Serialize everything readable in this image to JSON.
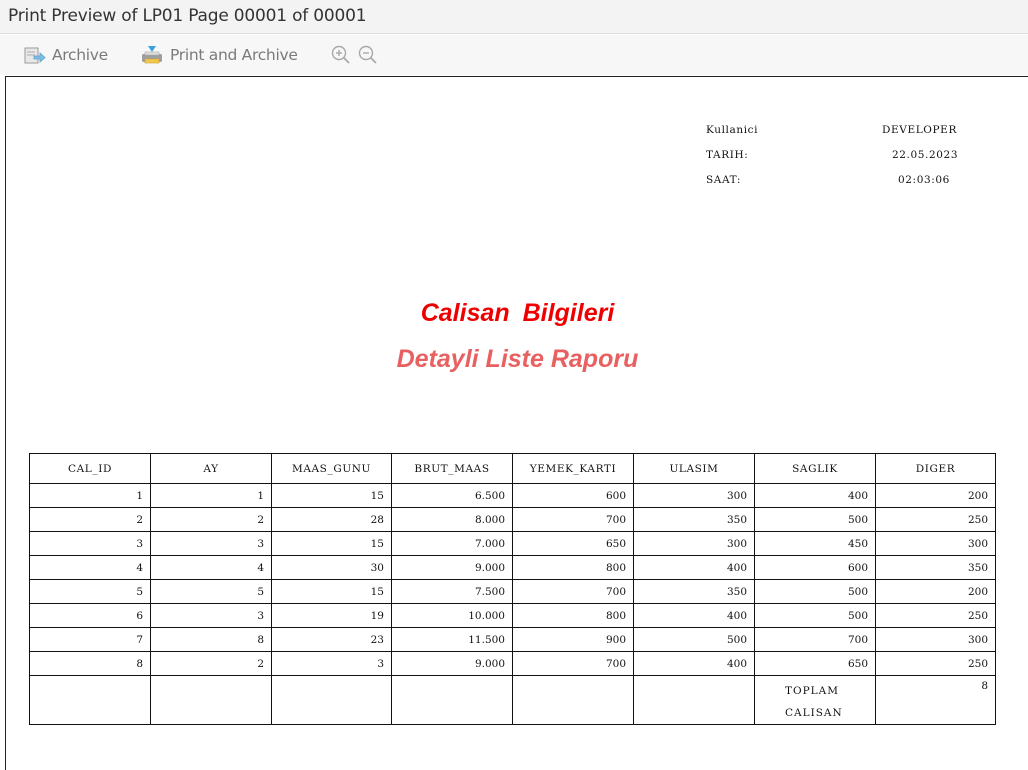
{
  "window": {
    "title": "Print Preview of LP01 Page 00001 of 00001"
  },
  "toolbar": {
    "archive_label": "Archive",
    "print_archive_label": "Print and Archive",
    "icons": [
      "archive-icon",
      "print-archive-icon",
      "zoom-in-icon",
      "zoom-out-icon"
    ]
  },
  "report": {
    "meta": {
      "user_label": "Kullanici",
      "user_value": "DEVELOPER",
      "date_label": "TARIH:",
      "date_value": "22.05.2023",
      "time_label": "SAAT:",
      "time_value": "02:03:06"
    },
    "title": "Calisan  Bilgileri",
    "subtitle": "Detayli Liste Raporu",
    "columns": [
      "CAL_ID",
      "AY",
      "MAAS_GUNU",
      "BRUT_MAAS",
      "YEMEK_KARTI",
      "ULASIM",
      "SAGLIK",
      "DIGER"
    ],
    "rows": [
      [
        "1",
        "1",
        "15",
        "6.500",
        "600",
        "300",
        "400",
        "200"
      ],
      [
        "2",
        "2",
        "28",
        "8.000",
        "700",
        "350",
        "500",
        "250"
      ],
      [
        "3",
        "3",
        "15",
        "7.000",
        "650",
        "300",
        "450",
        "300"
      ],
      [
        "4",
        "4",
        "30",
        "9.000",
        "800",
        "400",
        "600",
        "350"
      ],
      [
        "5",
        "5",
        "15",
        "7.500",
        "700",
        "350",
        "500",
        "200"
      ],
      [
        "6",
        "3",
        "19",
        "10.000",
        "800",
        "400",
        "500",
        "250"
      ],
      [
        "7",
        "8",
        "23",
        "11.500",
        "900",
        "500",
        "700",
        "300"
      ],
      [
        "8",
        "2",
        "3",
        "9.000",
        "700",
        "400",
        "650",
        "250"
      ]
    ],
    "total": {
      "label_line1": "TOPLAM",
      "label_line2": "CALISAN",
      "value": "8"
    }
  },
  "colors": {
    "title_red": "#ee0000",
    "subtitle_red": "#e86060"
  }
}
